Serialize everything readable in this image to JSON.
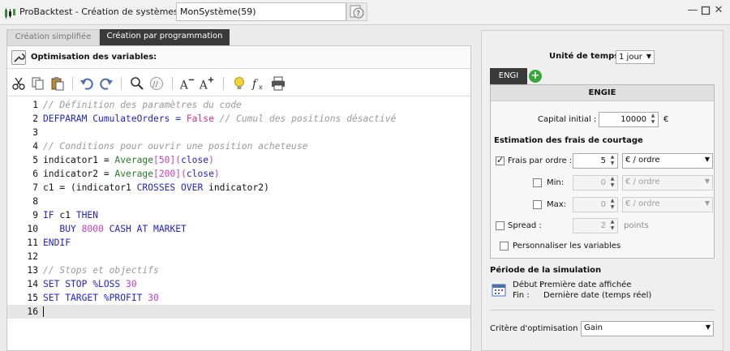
{
  "window": {
    "title": "ProBacktest - Création de systèmes de trading",
    "system_name": "MonSystème(59)"
  },
  "tabs": [
    {
      "label": "Création simplifiée"
    },
    {
      "label": "Création par programmation"
    }
  ],
  "section_title": "Optimisation des variables:",
  "code_lines": [
    {
      "n": "1",
      "parts": [
        {
          "t": "// Définition des paramètres du code",
          "c": "c-comment"
        }
      ]
    },
    {
      "n": "2",
      "parts": [
        {
          "t": "DEFPARAM",
          "c": "c-kw"
        },
        {
          "t": " CumulateOrders = ",
          "c": "c-kw"
        },
        {
          "t": "False",
          "c": "c-bool"
        },
        {
          "t": " // Cumul des positions désactivé",
          "c": "c-comment"
        }
      ]
    },
    {
      "n": "3",
      "parts": []
    },
    {
      "n": "4",
      "parts": [
        {
          "t": "// Conditions pour ouvrir une position acheteuse",
          "c": "c-comment"
        }
      ]
    },
    {
      "n": "5",
      "parts": [
        {
          "t": "indicator1 = ",
          "c": ""
        },
        {
          "t": "Average",
          "c": "c-fn"
        },
        {
          "t": "[",
          "c": "c-num"
        },
        {
          "t": "50",
          "c": "c-num"
        },
        {
          "t": "]",
          "c": "c-num"
        },
        {
          "t": "(",
          "c": "c-num"
        },
        {
          "t": "close",
          "c": "c-kw"
        },
        {
          "t": ")",
          "c": "c-num"
        }
      ]
    },
    {
      "n": "6",
      "parts": [
        {
          "t": "indicator2 = ",
          "c": ""
        },
        {
          "t": "Average",
          "c": "c-fn"
        },
        {
          "t": "[",
          "c": "c-num"
        },
        {
          "t": "200",
          "c": "c-num"
        },
        {
          "t": "]",
          "c": "c-num"
        },
        {
          "t": "(",
          "c": "c-num"
        },
        {
          "t": "close",
          "c": "c-kw"
        },
        {
          "t": ")",
          "c": "c-num"
        }
      ]
    },
    {
      "n": "7",
      "parts": [
        {
          "t": "c1 = (indicator1 ",
          "c": ""
        },
        {
          "t": "CROSSES OVER",
          "c": "c-kw"
        },
        {
          "t": " indicator2)",
          "c": ""
        }
      ]
    },
    {
      "n": "8",
      "parts": []
    },
    {
      "n": "9",
      "parts": [
        {
          "t": "IF",
          "c": "c-kw"
        },
        {
          "t": " c1 ",
          "c": ""
        },
        {
          "t": "THEN",
          "c": "c-kw"
        }
      ]
    },
    {
      "n": "10",
      "parts": [
        {
          "t": "   BUY ",
          "c": "c-kw"
        },
        {
          "t": "8000",
          "c": "c-num"
        },
        {
          "t": " CASH AT MARKET",
          "c": "c-kw"
        }
      ]
    },
    {
      "n": "11",
      "parts": [
        {
          "t": "ENDIF",
          "c": "c-kw"
        }
      ]
    },
    {
      "n": "12",
      "parts": []
    },
    {
      "n": "13",
      "parts": [
        {
          "t": "// Stops et objectifs",
          "c": "c-comment"
        }
      ]
    },
    {
      "n": "14",
      "parts": [
        {
          "t": "SET STOP %LOSS ",
          "c": "c-kw"
        },
        {
          "t": "30",
          "c": "c-num"
        }
      ]
    },
    {
      "n": "15",
      "parts": [
        {
          "t": "SET TARGET %PROFIT ",
          "c": "c-kw"
        },
        {
          "t": "30",
          "c": "c-num"
        }
      ]
    },
    {
      "n": "16",
      "parts": []
    }
  ],
  "settings": {
    "timeframe_label": "Unité de temps :",
    "timeframe_value": "1 jour",
    "stock_tab": "ENGI",
    "stock_name": "ENGIE",
    "capital_label": "Capital initial :",
    "capital_value": "10000",
    "currency": "€",
    "fees_title": "Estimation des frais de courtage",
    "fee_per_order_label": "Frais par ordre :",
    "fee_per_order_value": "5",
    "fee_per_order_unit": "€ / ordre",
    "min_label": "Min:",
    "min_value": "0",
    "min_unit": "€ / ordre",
    "max_label": "Max:",
    "max_value": "0",
    "max_unit": "€ / ordre",
    "spread_label": "Spread :",
    "spread_value": "2",
    "spread_unit": "points",
    "custom_vars_label": "Personnaliser les variables",
    "period_title": "Période de la simulation",
    "start_label": "Début :",
    "start_value": "Première date affichée",
    "end_label": "Fin :",
    "end_value": "Dernière date (temps réel)",
    "criterion_label": "Critère d'optimisation :",
    "criterion_value": "Gain"
  }
}
